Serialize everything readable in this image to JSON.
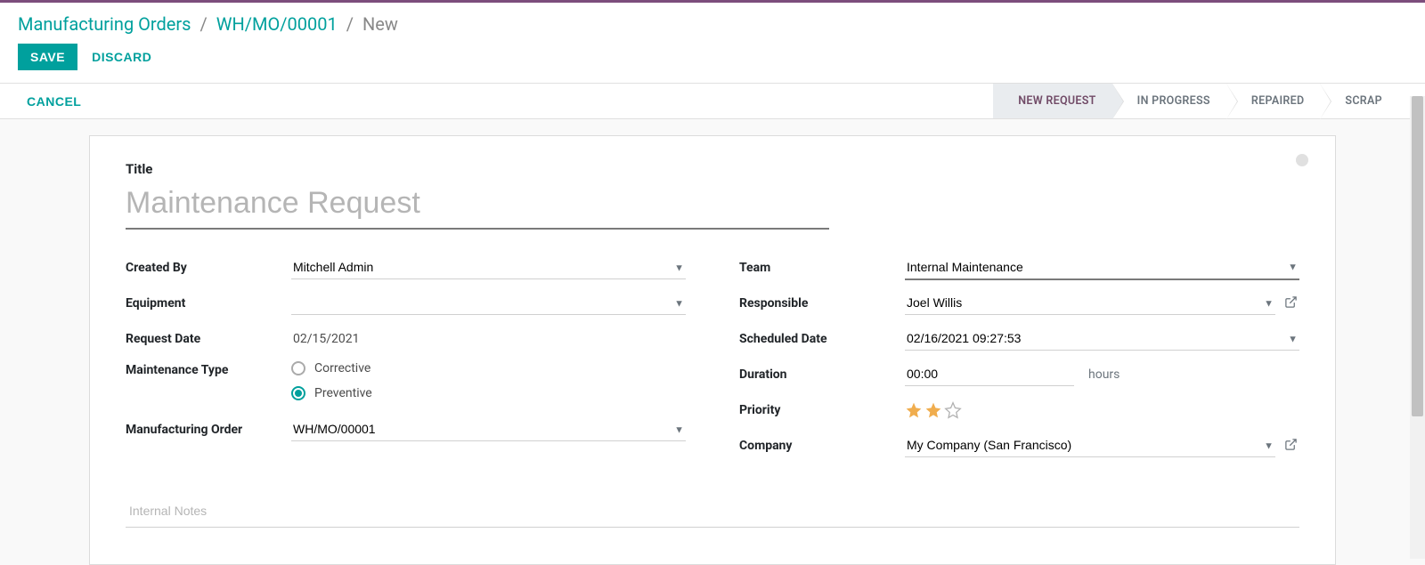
{
  "breadcrumb": {
    "root": "Manufacturing Orders",
    "parent": "WH/MO/00001",
    "current": "New",
    "sep": "/"
  },
  "actions": {
    "save": "SAVE",
    "discard": "DISCARD",
    "cancel": "CANCEL"
  },
  "stages": {
    "new_request": "NEW REQUEST",
    "in_progress": "IN PROGRESS",
    "repaired": "REPAIRED",
    "scrap": "SCRAP"
  },
  "form": {
    "title_label": "Title",
    "title_placeholder": "Maintenance Request",
    "title_value": "",
    "left": {
      "created_by": {
        "label": "Created By",
        "value": "Mitchell Admin"
      },
      "equipment": {
        "label": "Equipment",
        "value": ""
      },
      "request_date": {
        "label": "Request Date",
        "value": "02/15/2021"
      },
      "maintenance_type": {
        "label": "Maintenance Type",
        "corrective": "Corrective",
        "preventive": "Preventive",
        "selected": "preventive"
      },
      "manufacturing_order": {
        "label": "Manufacturing Order",
        "value": "WH/MO/00001"
      }
    },
    "right": {
      "team": {
        "label": "Team",
        "value": "Internal Maintenance"
      },
      "responsible": {
        "label": "Responsible",
        "value": "Joel Willis"
      },
      "scheduled_date": {
        "label": "Scheduled Date",
        "value": "02/16/2021 09:27:53"
      },
      "duration": {
        "label": "Duration",
        "value": "00:00",
        "unit": "hours"
      },
      "priority": {
        "label": "Priority",
        "value": 2,
        "max": 3
      },
      "company": {
        "label": "Company",
        "value": "My Company (San Francisco)"
      }
    },
    "notes_placeholder": "Internal Notes"
  },
  "colors": {
    "teal": "#00a09d",
    "star_active": "#f0ad4e",
    "star_inactive": "#c0c0c0"
  }
}
